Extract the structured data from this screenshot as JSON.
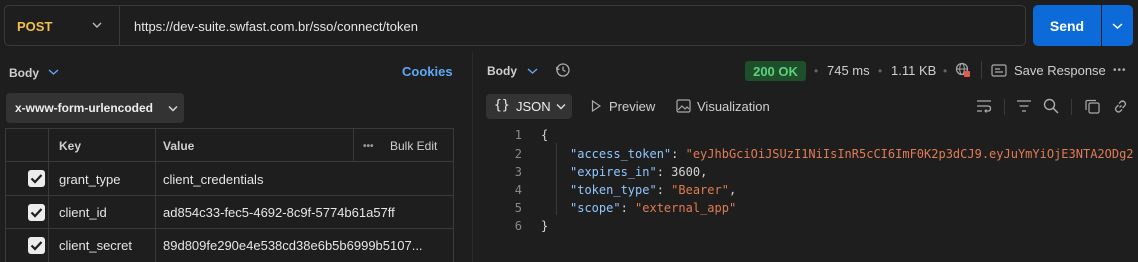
{
  "request": {
    "method": "POST",
    "url": "https://dev-suite.swfast.com.br/sso/connect/token",
    "send_label": "Send"
  },
  "body_panel": {
    "title": "Body",
    "cookies_label": "Cookies",
    "body_type": "x-www-form-urlencoded",
    "columns": {
      "key": "Key",
      "value": "Value",
      "bulk_edit": "Bulk Edit"
    },
    "rows": [
      {
        "checked": true,
        "key": "grant_type",
        "value": "client_credentials"
      },
      {
        "checked": true,
        "key": "client_id",
        "value": "ad854c33-fec5-4692-8c9f-5774b61a57ff"
      },
      {
        "checked": true,
        "key": "client_secret",
        "value": "89d809fe290e4e538cd38e6b5b6999b5107..."
      }
    ]
  },
  "response": {
    "title": "Body",
    "status": "200 OK",
    "time": "745 ms",
    "size": "1.11 KB",
    "save_label": "Save Response",
    "tabs": {
      "json": "JSON",
      "preview": "Preview",
      "visualization": "Visualization"
    },
    "lines": [
      {
        "num": "1",
        "text": "{"
      },
      {
        "num": "2",
        "key": "\"access_token\"",
        "value": "\"eyJhbGciOiJSUzI1NiIsInR5cCI6ImF0K2p3dCJ9.eyJuYmYiOjE3NTA2ODg2"
      },
      {
        "num": "3",
        "key": "\"expires_in\"",
        "value": "3600"
      },
      {
        "num": "4",
        "key": "\"token_type\"",
        "value": "\"Bearer\""
      },
      {
        "num": "5",
        "key": "\"scope\"",
        "value": "\"external_app\""
      },
      {
        "num": "6",
        "text": "}"
      }
    ]
  },
  "colors": {
    "accent": "#0c6bd8",
    "method": "#f0c14b",
    "status_ok": "#5fd07c",
    "json_key": "#8fc7ff",
    "json_string": "#e07b53"
  }
}
